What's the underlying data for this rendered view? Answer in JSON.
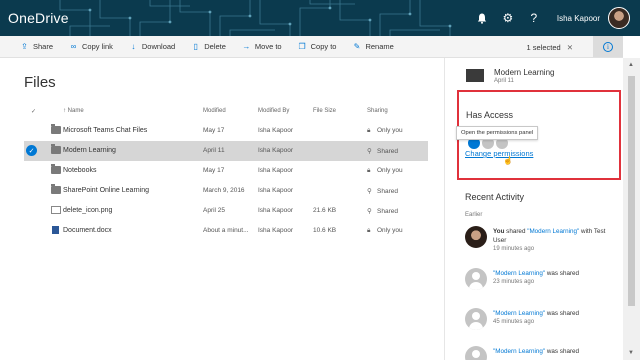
{
  "header": {
    "brand": "OneDrive",
    "user_name": "Isha Kapoor",
    "icons": [
      "bell-icon",
      "gear-icon",
      "help-icon"
    ]
  },
  "commands": [
    {
      "label": "Share",
      "icon": "share-icon",
      "glyph": "⇪"
    },
    {
      "label": "Copy link",
      "icon": "link-icon",
      "glyph": "∞"
    },
    {
      "label": "Download",
      "icon": "download-icon",
      "glyph": "↓"
    },
    {
      "label": "Delete",
      "icon": "trash-icon",
      "glyph": "▯"
    },
    {
      "label": "Move to",
      "icon": "move-icon",
      "glyph": "→"
    },
    {
      "label": "Copy to",
      "icon": "copy-icon",
      "glyph": "❐"
    },
    {
      "label": "Rename",
      "icon": "rename-icon",
      "glyph": "✎"
    }
  ],
  "selection": {
    "label": "1 selected",
    "clear_glyph": "✕"
  },
  "files": {
    "title": "Files",
    "columns": {
      "name": "↑ Name",
      "modified": "Modified",
      "modified_by": "Modified By",
      "size": "File Size",
      "sharing": "Sharing"
    },
    "rows": [
      {
        "name": "Microsoft Teams Chat Files",
        "modified": "May 17",
        "modified_by": "Isha Kapoor",
        "size": "",
        "sharing": "Only you",
        "type": "folder",
        "selected": false
      },
      {
        "name": "Modern Learning",
        "modified": "April 11",
        "modified_by": "Isha Kapoor",
        "size": "",
        "sharing": "Shared",
        "type": "folder",
        "selected": true
      },
      {
        "name": "Notebooks",
        "modified": "May 17",
        "modified_by": "Isha Kapoor",
        "size": "",
        "sharing": "Only you",
        "type": "folder",
        "selected": false
      },
      {
        "name": "SharePoint Online Learning",
        "modified": "March 9, 2016",
        "modified_by": "Isha Kapoor",
        "size": "",
        "sharing": "Shared",
        "type": "folder",
        "selected": false
      },
      {
        "name": "delete_icon.png",
        "modified": "April 25",
        "modified_by": "Isha Kapoor",
        "size": "21.6 KB",
        "sharing": "Shared",
        "type": "image",
        "selected": false
      },
      {
        "name": "Document.docx",
        "modified": "About a minut...",
        "modified_by": "Isha Kapoor",
        "size": "10.6 KB",
        "sharing": "Only you",
        "type": "docx",
        "selected": false
      }
    ]
  },
  "details": {
    "item_name": "Modern Learning",
    "item_date": "April 11",
    "has_access_title": "Has Access",
    "tooltip": "Open the permissions panel",
    "change_permissions": "Change permissions",
    "recent_activity_title": "Recent Activity",
    "earlier_label": "Earlier",
    "activities": [
      {
        "pre": "You",
        "mid": " shared ",
        "link": "\"Modern Learning\"",
        "post": " with Test User",
        "time": "19 minutes ago",
        "avatar": "photo"
      },
      {
        "pre": "",
        "mid": "",
        "link": "\"Modern Learning\"",
        "post": " was shared",
        "time": "23 minutes ago",
        "avatar": "generic"
      },
      {
        "pre": "",
        "mid": "",
        "link": "\"Modern Learning\"",
        "post": " was shared",
        "time": "45 minutes ago",
        "avatar": "generic"
      },
      {
        "pre": "",
        "mid": "",
        "link": "\"Modern Learning\"",
        "post": " was shared",
        "time": "",
        "avatar": "generic"
      }
    ]
  },
  "colors": {
    "accent": "#0078d4",
    "header_bg": "#0b3a4e",
    "highlight_box": "#e0313b",
    "selected_row": "#d6d6d6"
  }
}
